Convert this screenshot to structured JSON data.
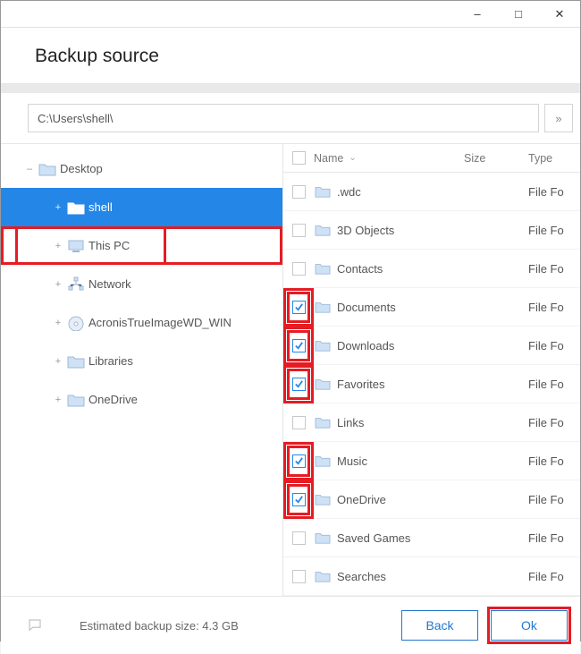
{
  "titlebar": {
    "minimize": "–",
    "maximize": "□",
    "close": "✕"
  },
  "header": {
    "title": "Backup source"
  },
  "path": {
    "value": "C:\\Users\\shell\\",
    "go": "»"
  },
  "tree": {
    "items": [
      {
        "label": "Desktop",
        "icon": "folder",
        "level": 0,
        "expander": "–",
        "selected": false,
        "hi": false
      },
      {
        "label": "shell",
        "icon": "folder-open",
        "level": 1,
        "expander": "+",
        "selected": true,
        "hi": true
      },
      {
        "label": "This PC",
        "icon": "pc",
        "level": 1,
        "expander": "+",
        "selected": false,
        "hi": true
      },
      {
        "label": "Network",
        "icon": "network",
        "level": 2,
        "expander": "+",
        "selected": false,
        "hi": false
      },
      {
        "label": "AcronisTrueImageWD_WIN",
        "icon": "disc",
        "level": 2,
        "expander": "+",
        "selected": false,
        "hi": false
      },
      {
        "label": "Libraries",
        "icon": "folder",
        "level": 2,
        "expander": "+",
        "selected": false,
        "hi": false
      },
      {
        "label": "OneDrive",
        "icon": "folder",
        "level": 2,
        "expander": "+",
        "selected": false,
        "hi": false
      }
    ]
  },
  "list": {
    "columns": {
      "name": "Name",
      "size": "Size",
      "type": "Type"
    },
    "rows": [
      {
        "name": ".wdc",
        "type": "File Fo",
        "checked": false,
        "hi": false
      },
      {
        "name": "3D Objects",
        "type": "File Fo",
        "checked": false,
        "hi": false
      },
      {
        "name": "Contacts",
        "type": "File Fo",
        "checked": false,
        "hi": false
      },
      {
        "name": "Documents",
        "type": "File Fo",
        "checked": true,
        "hi": true
      },
      {
        "name": "Downloads",
        "type": "File Fo",
        "checked": true,
        "hi": true
      },
      {
        "name": "Favorites",
        "type": "File Fo",
        "checked": true,
        "hi": true
      },
      {
        "name": "Links",
        "type": "File Fo",
        "checked": false,
        "hi": false
      },
      {
        "name": "Music",
        "type": "File Fo",
        "checked": true,
        "hi": true
      },
      {
        "name": "OneDrive",
        "type": "File Fo",
        "checked": true,
        "hi": true
      },
      {
        "name": "Saved Games",
        "type": "File Fo",
        "checked": false,
        "hi": false
      },
      {
        "name": "Searches",
        "type": "File Fo",
        "checked": false,
        "hi": false
      }
    ]
  },
  "footer": {
    "size_label": "Estimated backup size: 4.3 GB",
    "back": "Back",
    "ok": "Ok"
  }
}
